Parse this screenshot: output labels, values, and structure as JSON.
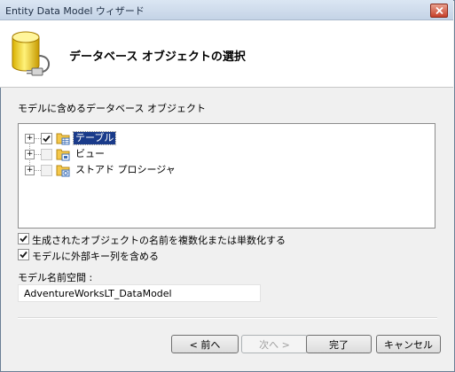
{
  "window": {
    "title": "Entity Data Model ウィザード"
  },
  "header": {
    "title": "データベース オブジェクトの選択"
  },
  "objects_section": {
    "label": "モデルに含めるデータベース オブジェクト",
    "tree": [
      {
        "label": "テーブル",
        "checked": true,
        "selected": true,
        "expander": "+"
      },
      {
        "label": "ビュー",
        "checked": false,
        "selected": false,
        "expander": "+"
      },
      {
        "label": "ストアド プロシージャ",
        "checked": false,
        "selected": false,
        "expander": "+"
      }
    ]
  },
  "options": {
    "pluralize": {
      "label": "生成されたオブジェクトの名前を複数化または単数化する",
      "checked": true
    },
    "foreign_keys": {
      "label": "モデルに外部キー列を含める",
      "checked": true
    }
  },
  "namespace": {
    "label": "モデル名前空間 :",
    "value": "AdventureWorksLT_DataModel"
  },
  "buttons": {
    "back": "< 前へ",
    "next": "次へ >",
    "finish": "完了",
    "cancel": "キャンセル"
  },
  "colors": {
    "selection": "#1a3b8a",
    "close_button": "#c6402a"
  }
}
